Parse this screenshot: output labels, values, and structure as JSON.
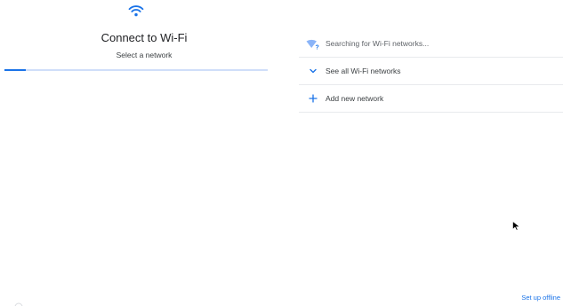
{
  "setup": {
    "title": "Connect to Wi-Fi",
    "subtitle": "Select a network",
    "progress_fraction": 0.08
  },
  "network_list": {
    "items": [
      {
        "icon": "wifi-searching-icon",
        "label": "Searching for Wi-Fi networks..."
      },
      {
        "icon": "chevron-down-icon",
        "label": "See all Wi-Fi networks"
      },
      {
        "icon": "plus-icon",
        "label": "Add new network"
      }
    ]
  },
  "footer": {
    "offline_label": "Set up offline"
  },
  "colors": {
    "accent": "#1a73e8",
    "progress_track": "#cfdef9",
    "divider": "#e8eaed"
  }
}
